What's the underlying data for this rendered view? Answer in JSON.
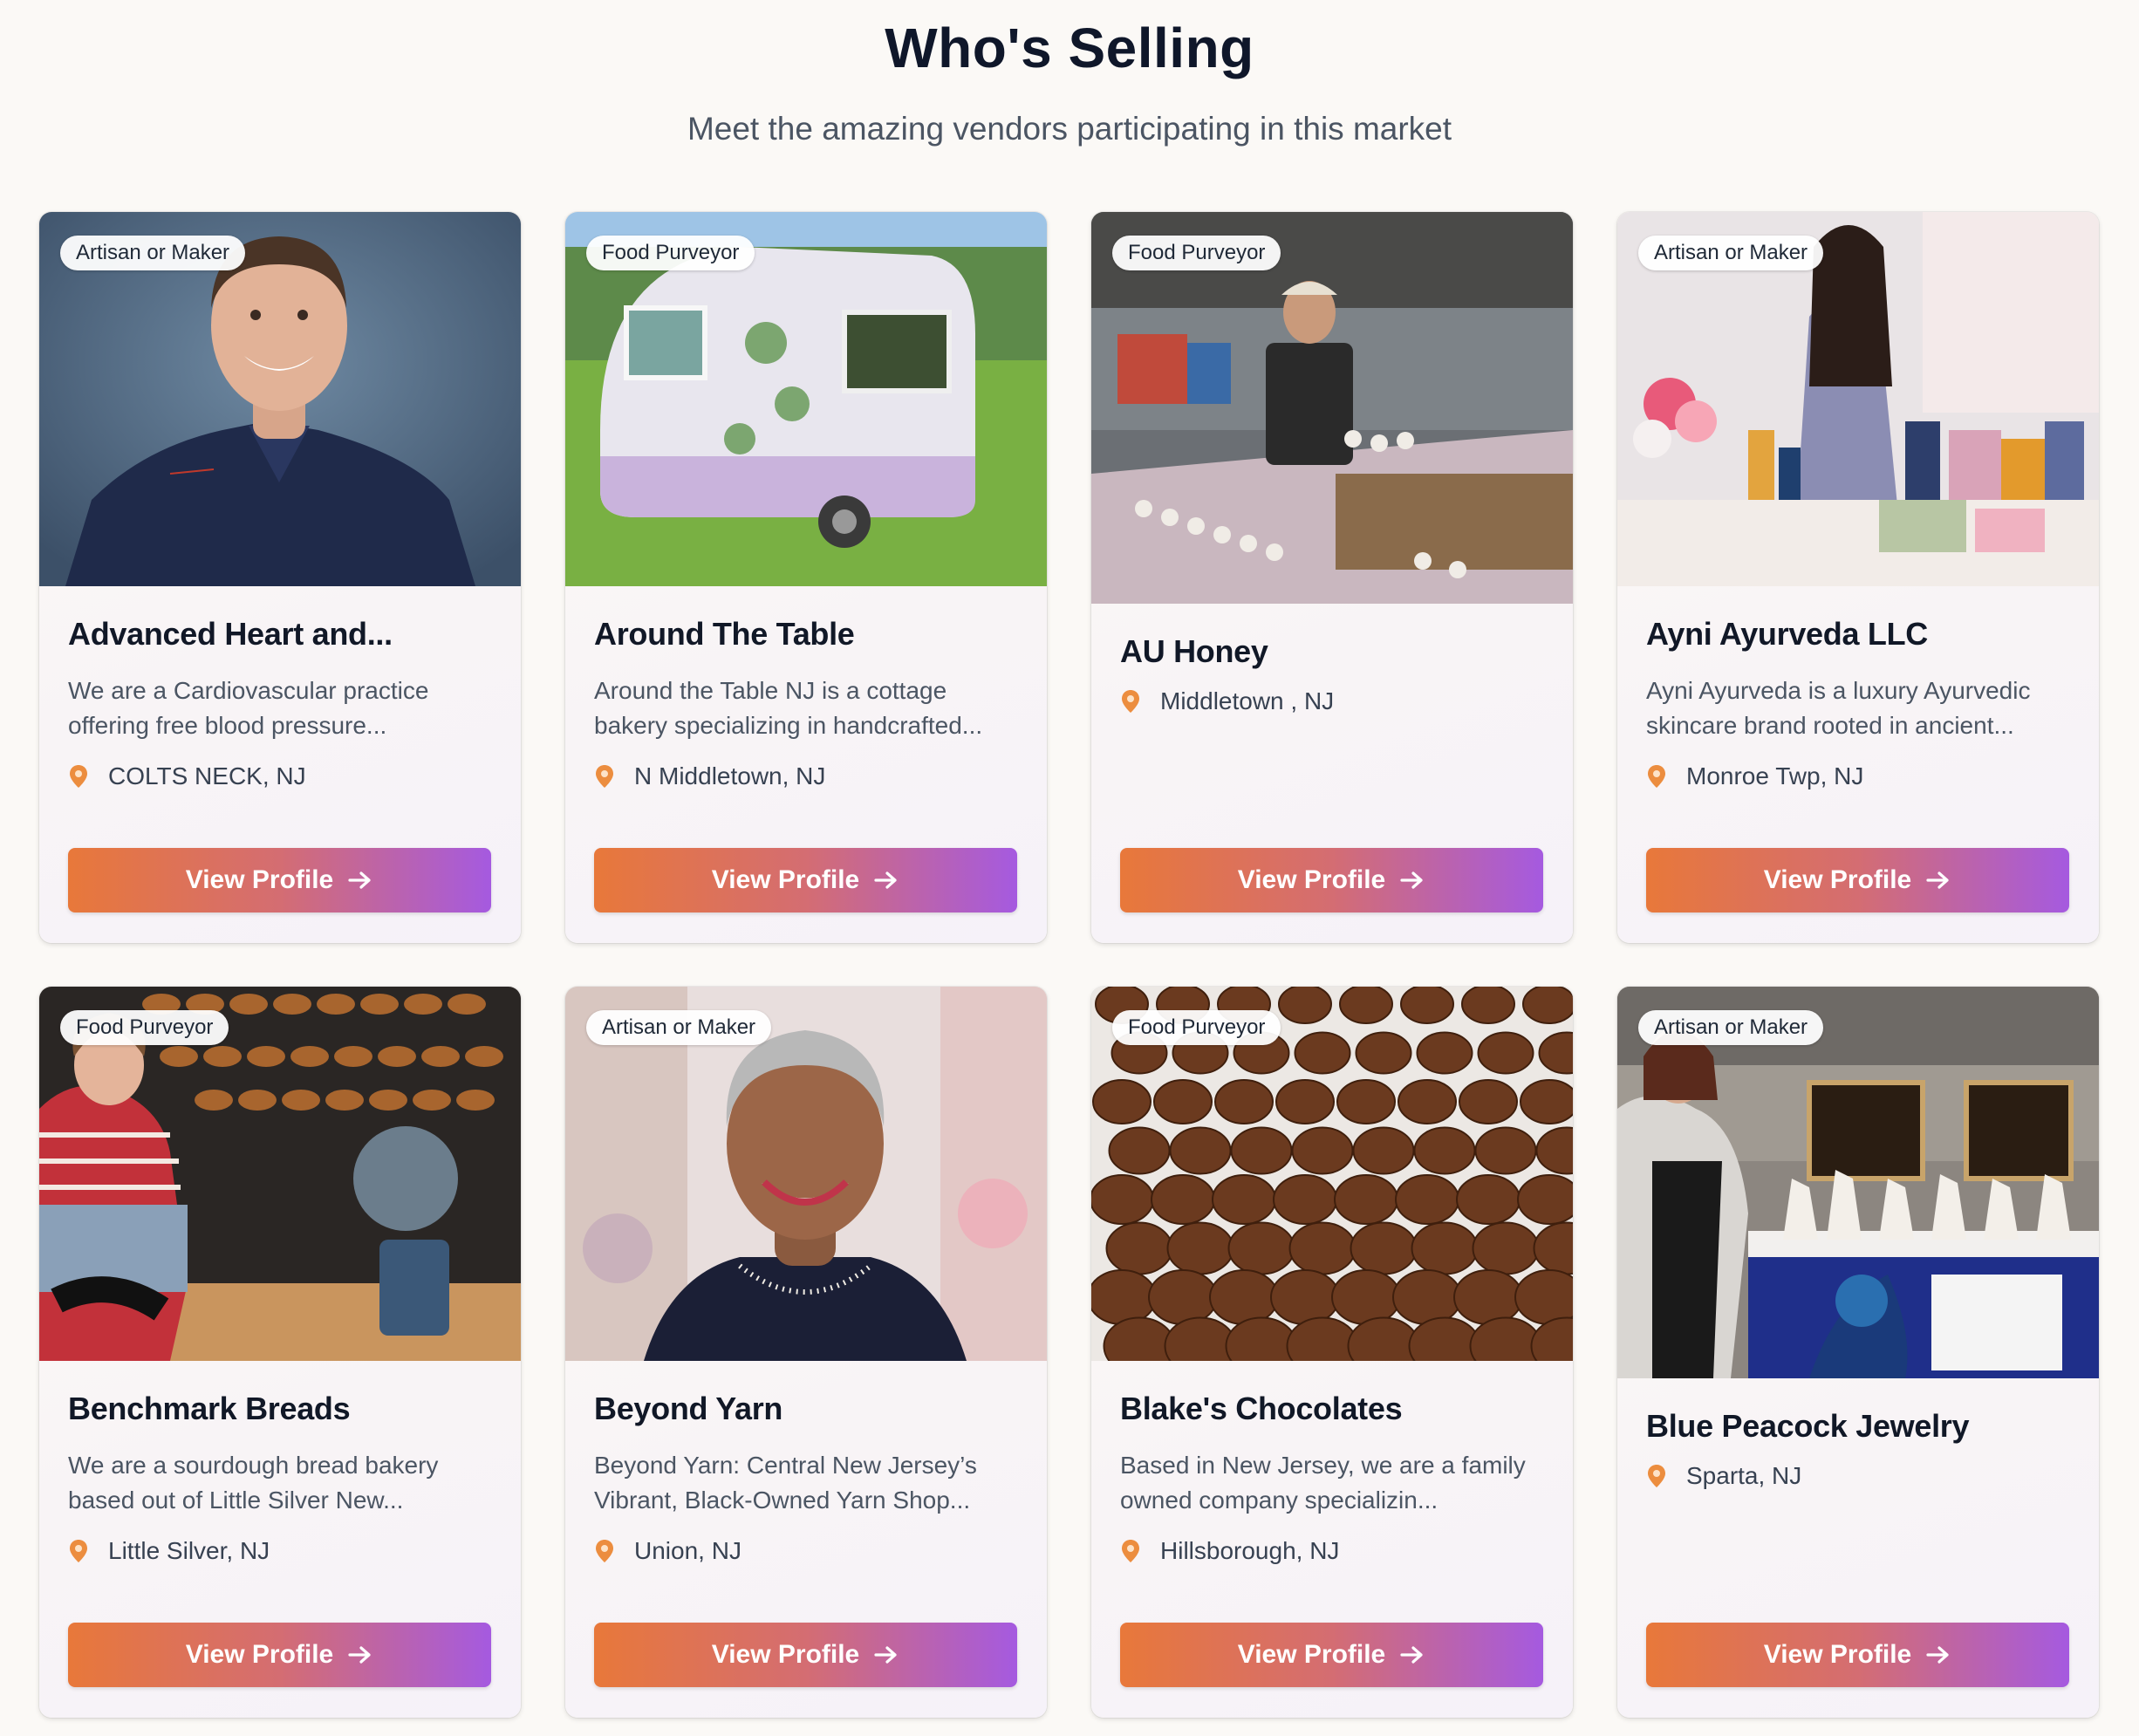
{
  "header": {
    "title": "Who's Selling",
    "subtitle": "Meet the amazing vendors participating in this market"
  },
  "colors": {
    "accent_orange": "#e8783a",
    "accent_purple": "#a55ae0",
    "pin": "#ec8d3f"
  },
  "vendors": [
    {
      "category": "Artisan or Maker",
      "name": "Advanced Heart and...",
      "description": "We are a Cardiovascular practice offering free blood pressure...",
      "location": "COLTS NECK, NJ",
      "button": "View Profile",
      "image": "portrait-doctor"
    },
    {
      "category": "Food Purveyor",
      "name": "Around The Table",
      "description": "Around the Table NJ is a cottage bakery specializing in handcrafted...",
      "location": "N Middletown, NJ",
      "button": "View Profile",
      "image": "cookie-trailer"
    },
    {
      "category": "Food Purveyor",
      "name": "AU Honey",
      "description": "",
      "location": "Middletown , NJ",
      "button": "View Profile",
      "image": "honey-stand"
    },
    {
      "category": "Artisan or Maker",
      "name": "Ayni Ayurveda LLC",
      "description": "Ayni Ayurveda is a luxury Ayurvedic skincare brand rooted in ancient...",
      "location": "Monroe Twp, NJ",
      "button": "View Profile",
      "image": "skincare-booth"
    },
    {
      "category": "Food Purveyor",
      "name": "Benchmark Breads",
      "description": "We are a sourdough bread bakery based out of Little Silver New...",
      "location": "Little Silver, NJ",
      "button": "View Profile",
      "image": "bakery"
    },
    {
      "category": "Artisan or Maker",
      "name": "Beyond Yarn",
      "description": "Beyond Yarn: Central New Jersey’s Vibrant, Black-Owned Yarn Shop...",
      "location": "Union, NJ",
      "button": "View Profile",
      "image": "portrait-woman"
    },
    {
      "category": "Food Purveyor",
      "name": "Blake's Chocolates",
      "description": "Based in New Jersey, we are a family owned company specializin...",
      "location": "Hillsborough, NJ",
      "button": "View Profile",
      "image": "chocolates"
    },
    {
      "category": "Artisan or Maker",
      "name": "Blue Peacock Jewelry",
      "description": "",
      "location": "Sparta, NJ",
      "button": "View Profile",
      "image": "jewelry-booth"
    }
  ]
}
